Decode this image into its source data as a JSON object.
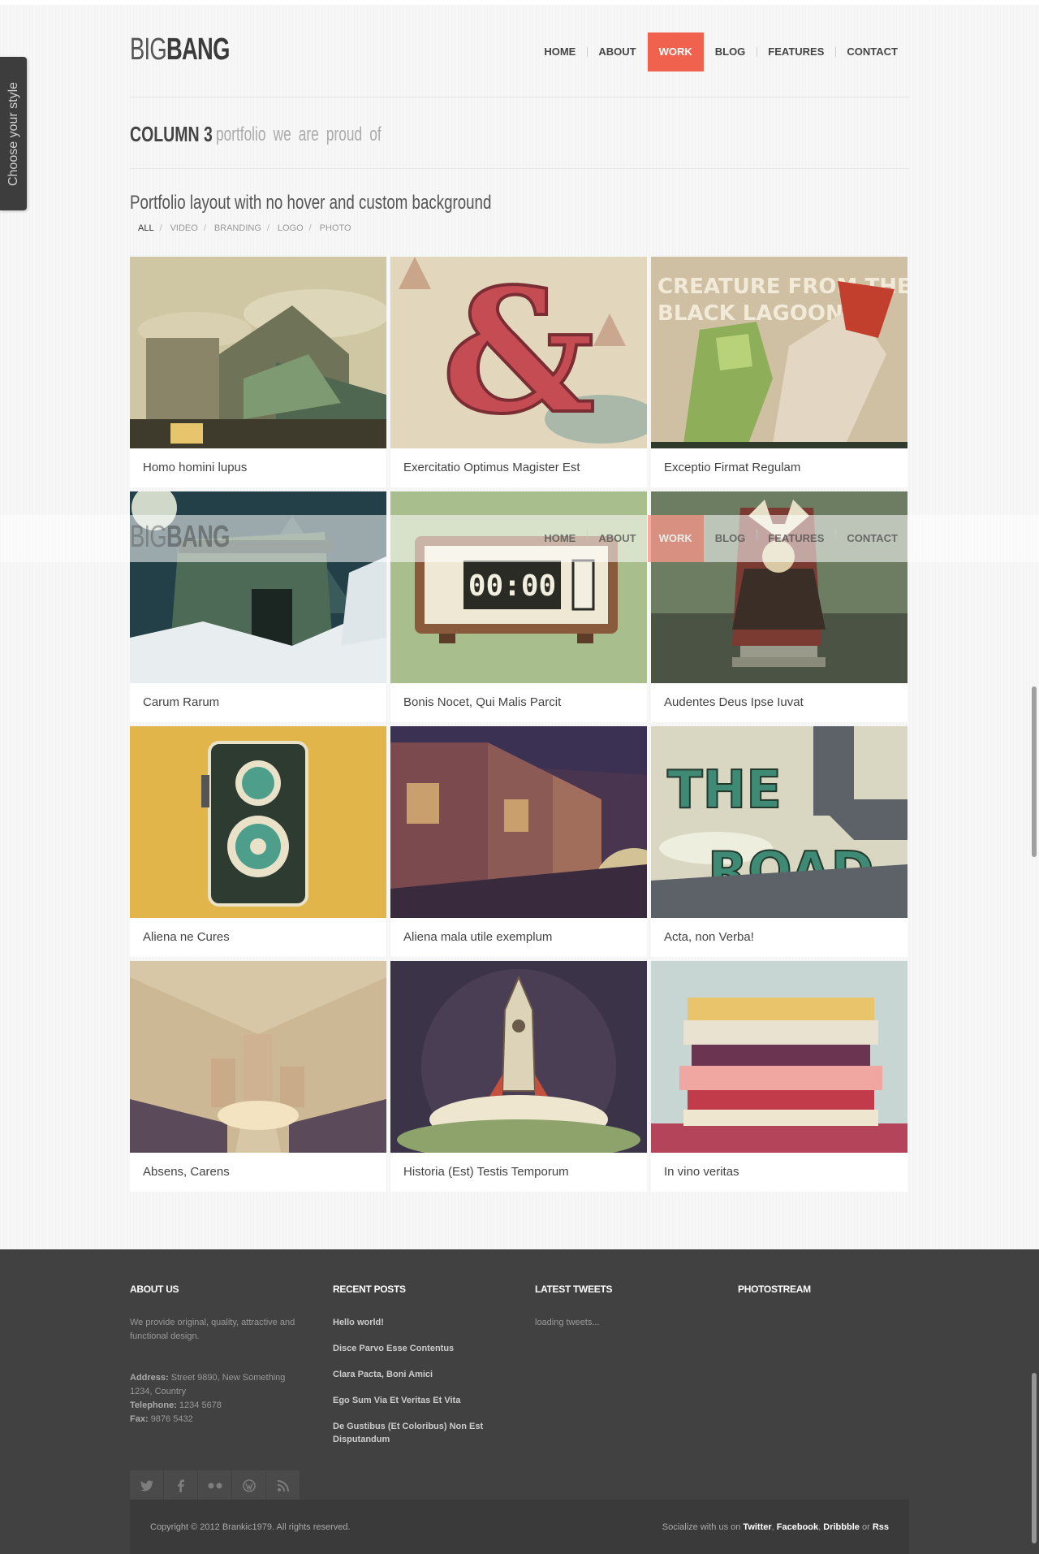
{
  "side_tab": {
    "label": "Choose your style"
  },
  "logo": {
    "light": "BIG",
    "bold": "BANG"
  },
  "nav": {
    "items": [
      "HOME",
      "ABOUT",
      "WORK",
      "BLOG",
      "FEATURES",
      "CONTACT"
    ],
    "active": "WORK"
  },
  "heading": {
    "strong": "COLUMN 3",
    "light": "portfolio we are proud of"
  },
  "subtitle": "Portfolio layout with no hover and custom background",
  "filters": [
    "ALL",
    "VIDEO",
    "BRANDING",
    "LOGO",
    "PHOTO"
  ],
  "portfolio": [
    "Homo homini lupus",
    "Exercitatio Optimus Magister Est",
    "Exceptio Firmat Regulam",
    "Carum Rarum",
    "Bonis Nocet, Qui Malis Parcit",
    "Audentes Deus Ipse Iuvat",
    "Aliena ne Cures",
    "Aliena mala utile exemplum",
    "Acta, non Verba!",
    "Absens, Carens",
    "Historia (Est) Testis Temporum",
    "In vino veritas"
  ],
  "thumb_text": {
    "creature_line1": "CREATURE FROM THE",
    "creature_line2": "BLACK LAGOON",
    "clock": "00:00",
    "road_line1": "THE",
    "road_line2": "ROAD"
  },
  "footer": {
    "about": {
      "title": "ABOUT US",
      "text": "We provide original, quality, attractive and functional design.",
      "address_label": "Address:",
      "address": "Street 9890, New Something 1234, Country",
      "telephone_label": "Telephone:",
      "telephone": "1234 5678",
      "fax_label": "Fax:",
      "fax": "9876 5432"
    },
    "recent": {
      "title": "RECENT POSTS",
      "posts": [
        "Hello world!",
        "Disce Parvo Esse Contentus",
        "Clara Pacta, Boni Amici",
        "Ego Sum Via Et Veritas Et Vita",
        "De Gustibus (Et Coloribus) Non Est Disputandum"
      ]
    },
    "tweets": {
      "title": "LATEST TWEETS",
      "text": "loading tweets..."
    },
    "photostream": {
      "title": "PHOTOSTREAM"
    },
    "social_icons": [
      "twitter-icon",
      "facebook-icon",
      "flickr-icon",
      "wordpress-icon",
      "rss-icon"
    ],
    "copyright": "Copyright © 2012 Brankic1979. All rights reserved.",
    "socialize": {
      "prefix": "Socialize with us on",
      "links": [
        "Twitter",
        "Facebook",
        "Dribbble",
        "Rss"
      ],
      "or": "or"
    }
  },
  "colors": {
    "accent": "#f0624d",
    "footer_bg": "#414141"
  }
}
